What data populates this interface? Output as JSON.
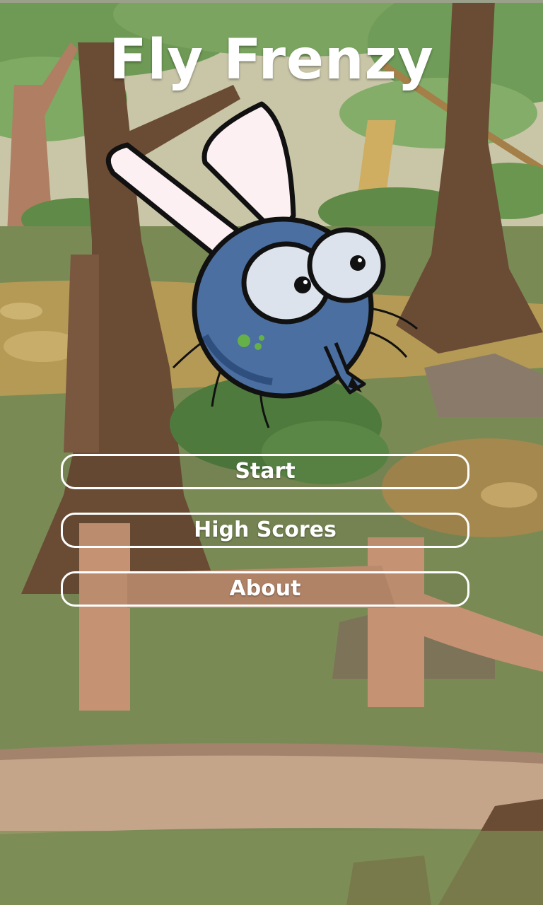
{
  "game": {
    "title": "Fly Frenzy"
  },
  "menu": {
    "start_label": "Start",
    "high_scores_label": "High Scores",
    "about_label": "About"
  },
  "colors": {
    "fly_body": "#4a6fa0",
    "fly_wing": "#fdf0f2",
    "tree_trunk": "#6a4b34",
    "grass": "#7a8a55",
    "button_border": "#ffffff"
  }
}
